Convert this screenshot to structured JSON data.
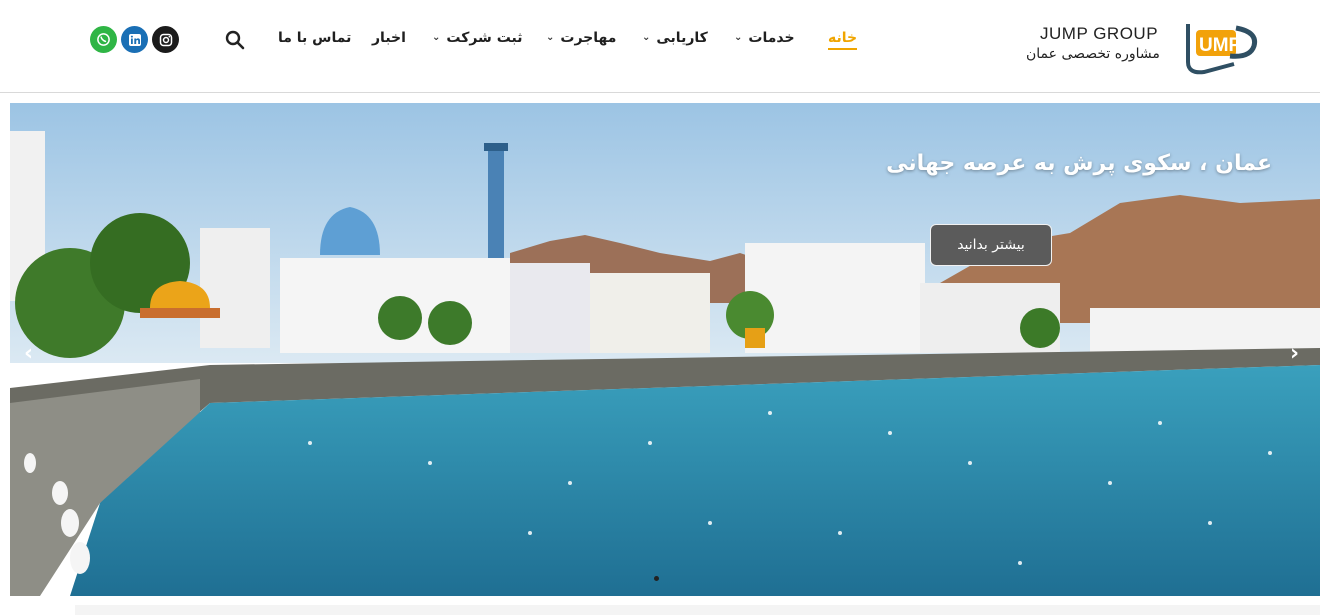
{
  "header": {
    "logo": {
      "title": "JUMP GROUP",
      "subtitle": "مشاوره تخصصی عمان",
      "mark": "UMP"
    },
    "nav": [
      {
        "label": "خانه",
        "active": true,
        "dropdown": false
      },
      {
        "label": "خدمات",
        "active": false,
        "dropdown": true
      },
      {
        "label": "کاریابی",
        "active": false,
        "dropdown": true
      },
      {
        "label": "مهاجرت",
        "active": false,
        "dropdown": true
      },
      {
        "label": "ثبت شرکت",
        "active": false,
        "dropdown": true
      },
      {
        "label": "اخبار",
        "active": false,
        "dropdown": false
      },
      {
        "label": "تماس با ما",
        "active": false,
        "dropdown": false
      }
    ],
    "search_icon": "search-icon",
    "social": [
      {
        "name": "whatsapp-icon",
        "color": "#2fb545"
      },
      {
        "name": "linkedin-icon",
        "color": "#1a6fb5"
      },
      {
        "name": "instagram-icon",
        "color": "#1b1b1b"
      }
    ],
    "accent_color": "#f0a500"
  },
  "hero": {
    "title": "عمان ، سکوی پرش به عرصه جهانی",
    "button_label": "بیشتر بدانید",
    "prev_icon": "chevron-left-icon",
    "next_icon": "chevron-right-icon",
    "water_color": "#2d8fae",
    "sky_color": "#c7def0"
  }
}
